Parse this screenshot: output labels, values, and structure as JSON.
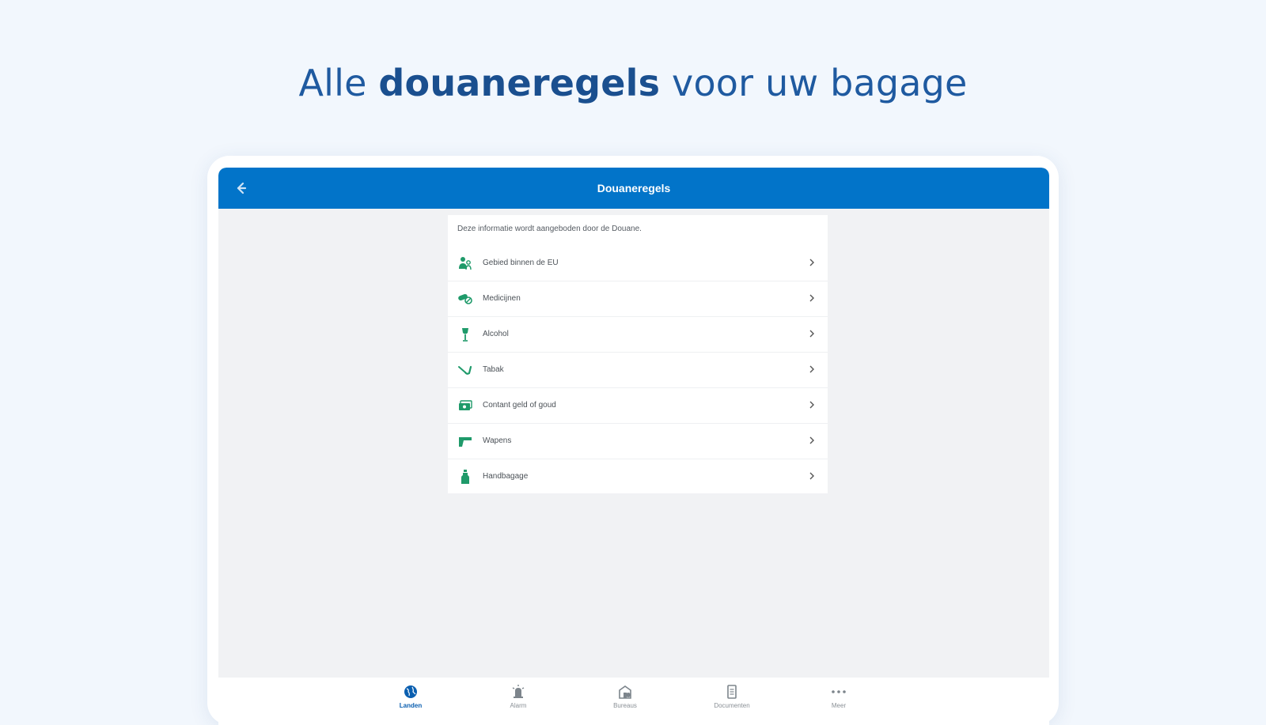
{
  "headline": {
    "prefix": "Alle ",
    "bold": "douaneregels",
    "suffix": " voor uw bagage"
  },
  "appbar": {
    "title": "Douaneregels",
    "back_icon": "arrow-left-icon"
  },
  "intro_text": "Deze informatie wordt aangeboden door de Douane.",
  "items": [
    {
      "label": "Gebied binnen de EU",
      "icon": "people-icon"
    },
    {
      "label": "Medicijnen",
      "icon": "pills-icon"
    },
    {
      "label": "Alcohol",
      "icon": "wine-glass-icon"
    },
    {
      "label": "Tabak",
      "icon": "pipe-icon"
    },
    {
      "label": "Contant geld of goud",
      "icon": "cash-icon"
    },
    {
      "label": "Wapens",
      "icon": "gun-icon"
    },
    {
      "label": "Handbagage",
      "icon": "bottle-icon"
    }
  ],
  "bottom_nav": [
    {
      "label": "Landen",
      "icon": "globe-icon",
      "active": true
    },
    {
      "label": "Alarm",
      "icon": "siren-icon",
      "active": false
    },
    {
      "label": "Bureaus",
      "icon": "building-icon",
      "active": false
    },
    {
      "label": "Documenten",
      "icon": "document-icon",
      "active": false
    },
    {
      "label": "Meer",
      "icon": "more-icon",
      "active": false
    }
  ],
  "colors": {
    "appbar": "#0274c9",
    "icon_green": "#1f9a6a",
    "headline": "#1f5aa0",
    "page_bg": "#f2f7fd"
  }
}
